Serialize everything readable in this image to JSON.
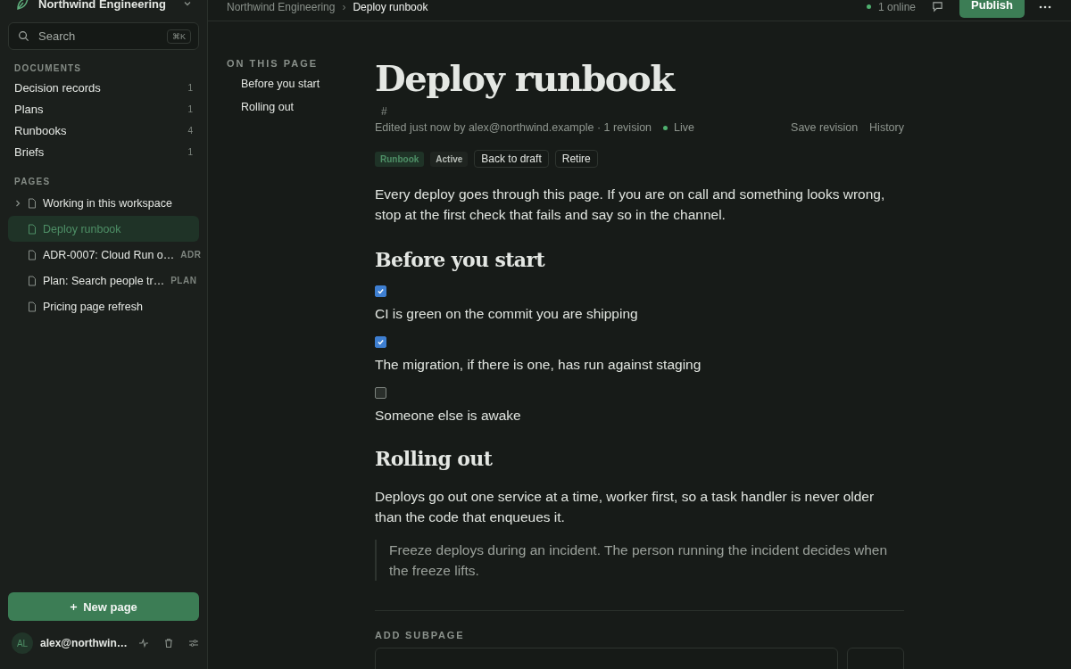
{
  "workspace": {
    "name": "Northwind Engineering"
  },
  "search": {
    "placeholder": "Search",
    "shortcut": "⌘K"
  },
  "sidebar": {
    "documents_label": "DOCUMENTS",
    "documents": [
      {
        "label": "Decision records",
        "count": "1"
      },
      {
        "label": "Plans",
        "count": "1"
      },
      {
        "label": "Runbooks",
        "count": "4"
      },
      {
        "label": "Briefs",
        "count": "1"
      }
    ],
    "pages_label": "PAGES",
    "pages": [
      {
        "title": "Working in this workspace",
        "kind": "group",
        "selected": false
      },
      {
        "title": "Deploy runbook",
        "kind": "page",
        "selected": true
      },
      {
        "title": "ADR-0007: Cloud Run o…",
        "kind": "page",
        "selected": false,
        "tag": "ADR"
      },
      {
        "title": "Plan: Search people tr…",
        "kind": "page",
        "selected": false,
        "tag": "PLAN"
      },
      {
        "title": "Pricing page refresh",
        "kind": "page",
        "selected": false
      }
    ],
    "new_page": "New page",
    "user": {
      "initials": "AL",
      "email": "alex@northwin…"
    }
  },
  "topbar": {
    "breadcrumb": [
      "Northwind Engineering",
      "Deploy runbook"
    ],
    "separator": "›",
    "online": "1 online",
    "publish": "Publish"
  },
  "toc": {
    "label": "ON THIS PAGE",
    "items": [
      "Before you start",
      "Rolling out"
    ]
  },
  "doc": {
    "title": "Deploy runbook",
    "anchor": "#",
    "meta": "Edited just now by alex@northwind.example · 1 revision",
    "status": "Live",
    "actions": [
      "Save revision",
      "History"
    ],
    "type_tag": "Runbook",
    "state_tag": "Active",
    "buttons": [
      "Back to draft",
      "Retire"
    ],
    "blocks": [
      {
        "kind": "paragraph",
        "text": "Every deploy goes through this page. If you are on call and something looks wrong, stop at the first check that fails and say so in the channel."
      },
      {
        "kind": "heading",
        "text": "Before you start"
      },
      {
        "kind": "check",
        "text": "CI is green on the commit you are shipping",
        "checked": true
      },
      {
        "kind": "check",
        "text": "The migration, if there is one, has run against staging",
        "checked": true
      },
      {
        "kind": "check",
        "text": "Someone else is awake",
        "checked": false
      },
      {
        "kind": "heading",
        "text": "Rolling out"
      },
      {
        "kind": "paragraph",
        "text": "Deploys go out one service at a time, worker first, so a task handler is never older than the code that enqueues it."
      },
      {
        "kind": "quote",
        "text": "Freeze deploys during an incident. The person running the incident decides when the freeze lifts."
      }
    ],
    "subpage_label": "ADD SUBPAGE"
  }
}
